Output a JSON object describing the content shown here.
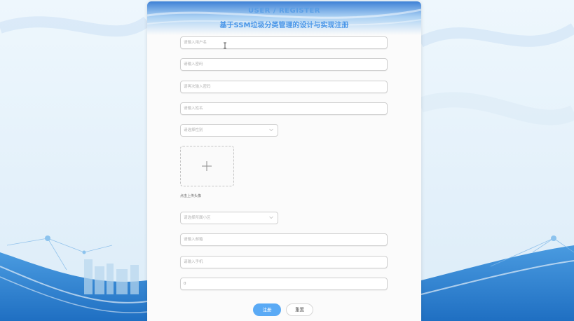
{
  "header": {
    "title_en": "USER / REGISTER",
    "title_cn": "基于SSM垃圾分类管理的设计与实现注册"
  },
  "form": {
    "username_placeholder": "请输入用户名",
    "password_placeholder": "请输入密码",
    "confirm_password_placeholder": "请再次输入密码",
    "name_placeholder": "请输入姓名",
    "gender_placeholder": "请选择性别",
    "avatar_label": "点击上传头像",
    "district_placeholder": "请选择所属小区",
    "email_placeholder": "请输入邮箱",
    "phone_placeholder": "请输入手机",
    "balance_value": "0"
  },
  "buttons": {
    "register": "注册",
    "reset": "重置"
  },
  "icons": [
    "chevron-down-icon",
    "plus-icon",
    "text-cursor-icon"
  ],
  "colors": {
    "title": "#5a9ee6",
    "primary_button": "#5aaaf5",
    "background": "#e9f4fc"
  }
}
